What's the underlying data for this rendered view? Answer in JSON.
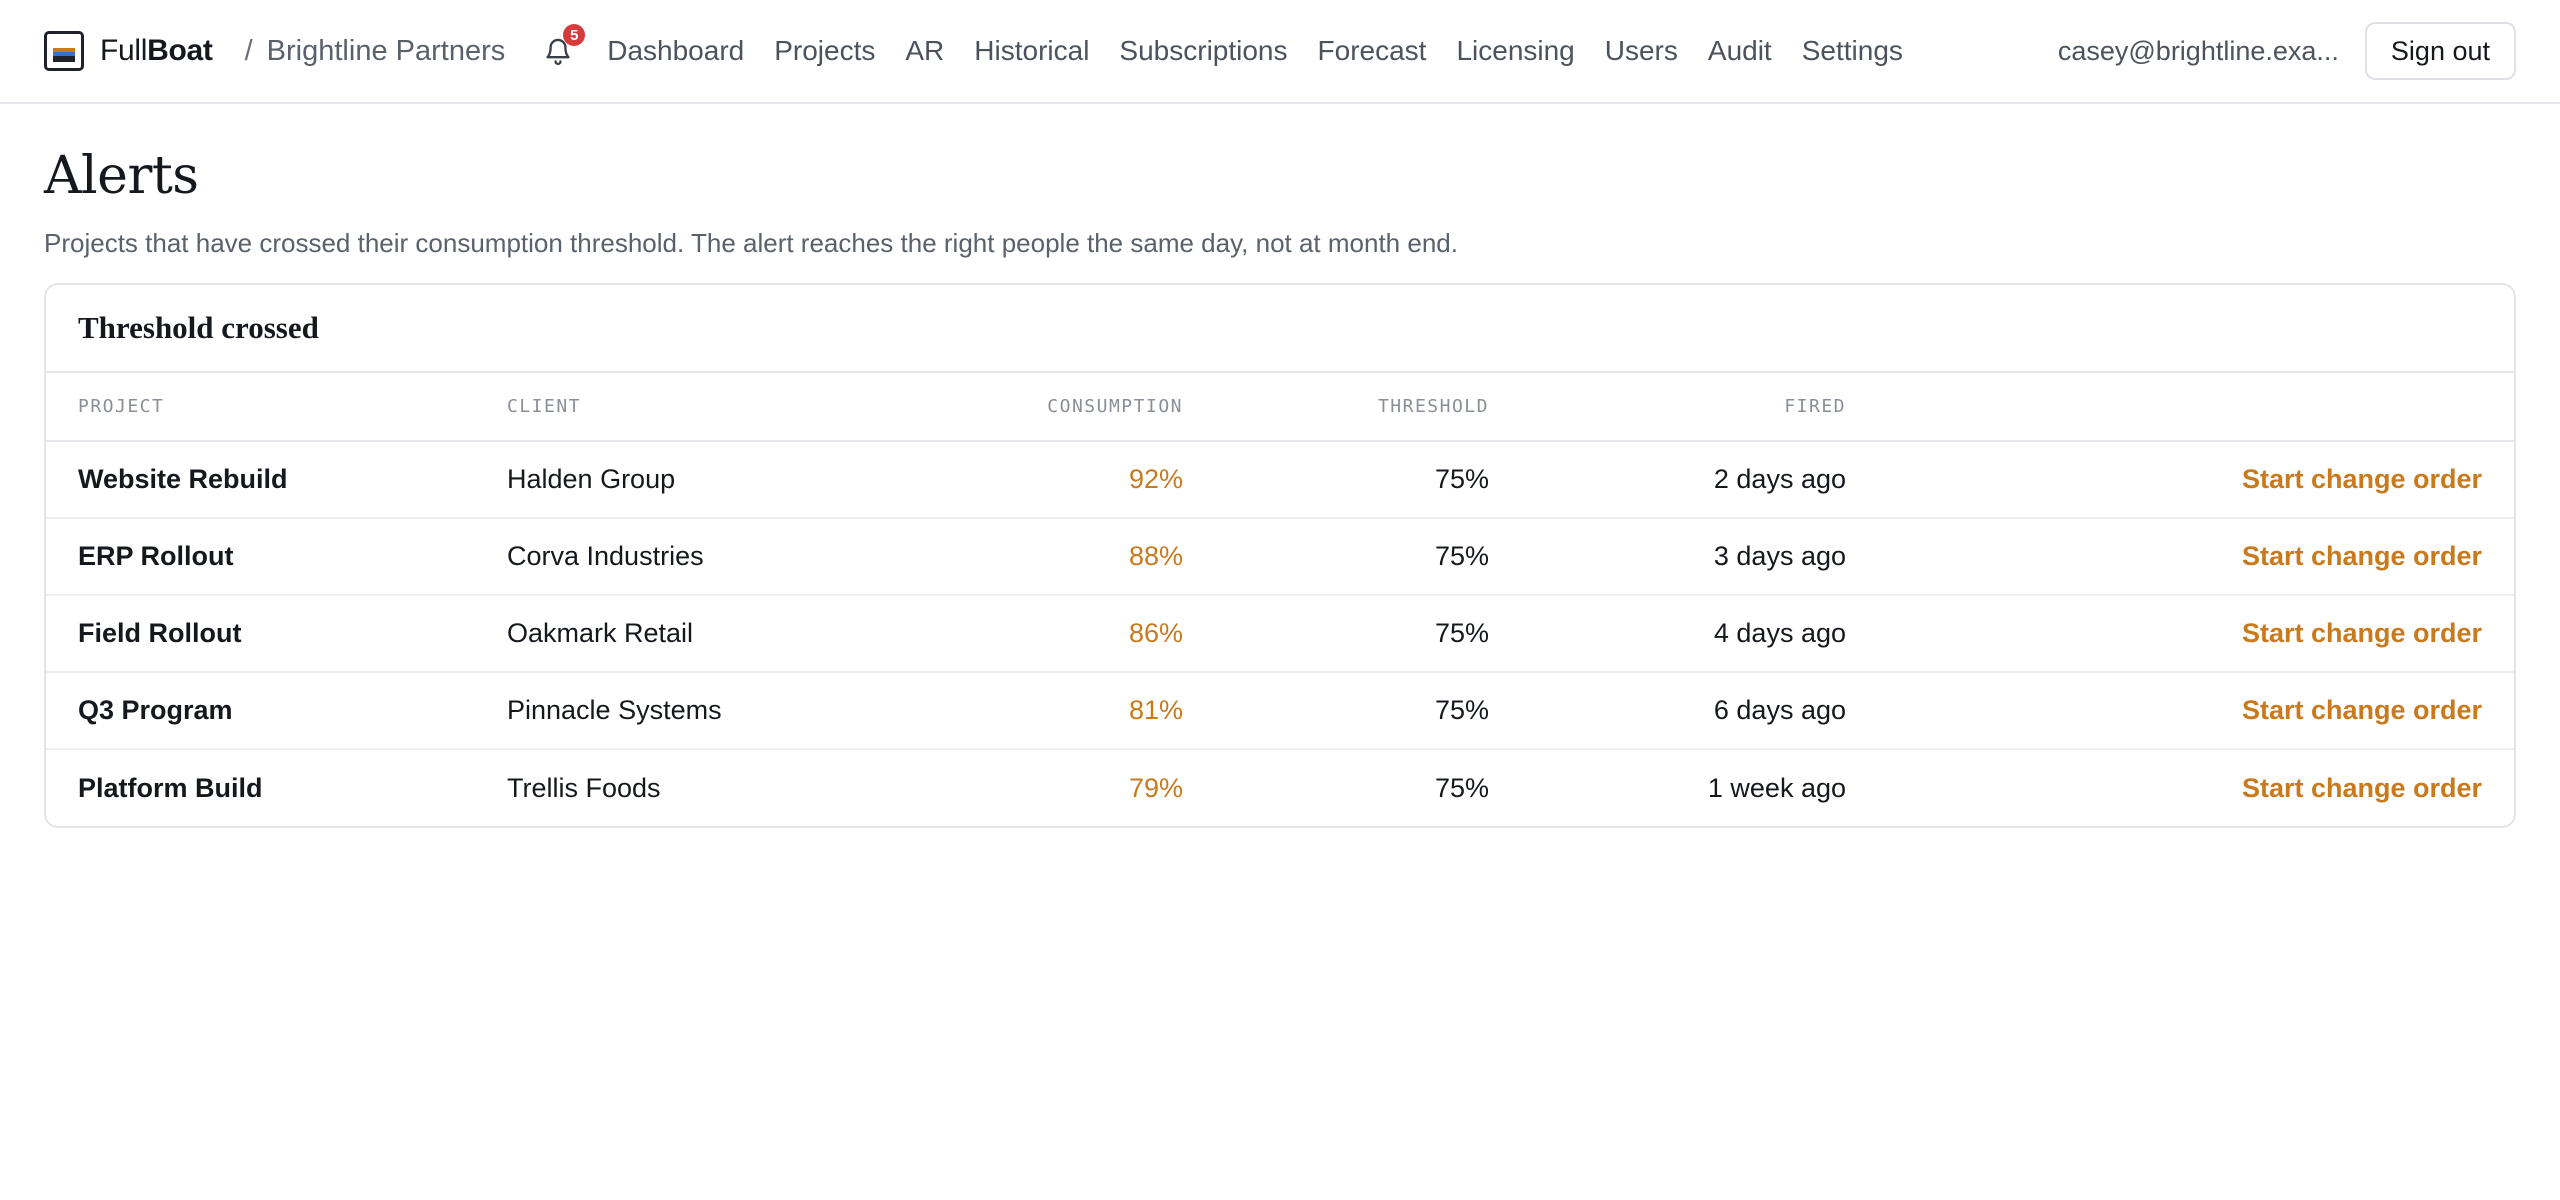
{
  "brand": {
    "name_light": "Full",
    "name_bold": "Boat"
  },
  "breadcrumb": {
    "separator": "/",
    "org": "Brightline Partners"
  },
  "notifications": {
    "count": "5"
  },
  "nav": [
    "Dashboard",
    "Projects",
    "AR",
    "Historical",
    "Subscriptions",
    "Forecast",
    "Licensing",
    "Users",
    "Audit",
    "Settings"
  ],
  "user": {
    "email": "casey@brightline.exa...",
    "signout_label": "Sign out"
  },
  "page": {
    "title": "Alerts",
    "subtitle": "Projects that have crossed their consumption threshold. The alert reaches the right people the same day, not at month end."
  },
  "panel": {
    "title": "Threshold crossed"
  },
  "table": {
    "columns": [
      "PROJECT",
      "CLIENT",
      "CONSUMPTION",
      "THRESHOLD",
      "FIRED",
      ""
    ],
    "rows": [
      {
        "project": "Website Rebuild",
        "client": "Halden Group",
        "consumption": "92%",
        "threshold": "75%",
        "fired": "2 days ago",
        "action": "Start change order"
      },
      {
        "project": "ERP Rollout",
        "client": "Corva Industries",
        "consumption": "88%",
        "threshold": "75%",
        "fired": "3 days ago",
        "action": "Start change order"
      },
      {
        "project": "Field Rollout",
        "client": "Oakmark Retail",
        "consumption": "86%",
        "threshold": "75%",
        "fired": "4 days ago",
        "action": "Start change order"
      },
      {
        "project": "Q3 Program",
        "client": "Pinnacle Systems",
        "consumption": "81%",
        "threshold": "75%",
        "fired": "6 days ago",
        "action": "Start change order"
      },
      {
        "project": "Platform Build",
        "client": "Trellis Foods",
        "consumption": "79%",
        "threshold": "75%",
        "fired": "1 week ago",
        "action": "Start change order"
      }
    ]
  },
  "colors": {
    "accent": "#c97a1d",
    "badge": "#d83b3b",
    "text": "#15181d",
    "muted": "#5b616b"
  },
  "icons": {
    "logo": "fullboat-logo-icon",
    "notifications": "bell-icon"
  }
}
